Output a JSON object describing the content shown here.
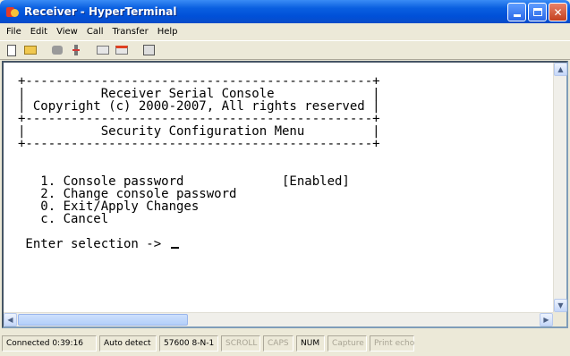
{
  "window": {
    "title": "Receiver - HyperTerminal"
  },
  "menu": [
    "File",
    "Edit",
    "View",
    "Call",
    "Transfer",
    "Help"
  ],
  "toolbar": {
    "buttons": [
      "new-icon",
      "open-icon",
      "call-icon",
      "disconnect-icon",
      "send-icon",
      "receive-icon",
      "properties-icon"
    ]
  },
  "terminal": {
    "lines": [
      "+----------------------------------------------+",
      "|          Receiver Serial Console             |",
      "| Copyright (c) 2000-2007, All rights reserved |",
      "+----------------------------------------------+",
      "|          Security Configuration Menu         |",
      "+----------------------------------------------+",
      "",
      "",
      "   1. Console password             [Enabled]",
      "   2. Change console password",
      "   0. Exit/Apply Changes",
      "   c. Cancel",
      "",
      " Enter selection -> "
    ]
  },
  "status": {
    "connected": "Connected 0:39:16",
    "detect": "Auto detect",
    "port": "57600 8-N-1",
    "scroll": "SCROLL",
    "caps": "CAPS",
    "num": "NUM",
    "capture": "Capture",
    "print": "Print echo"
  },
  "colors": {
    "titlebar": "#0050d8",
    "chrome": "#ece9d8",
    "terminal_bg": "#ffffff"
  }
}
